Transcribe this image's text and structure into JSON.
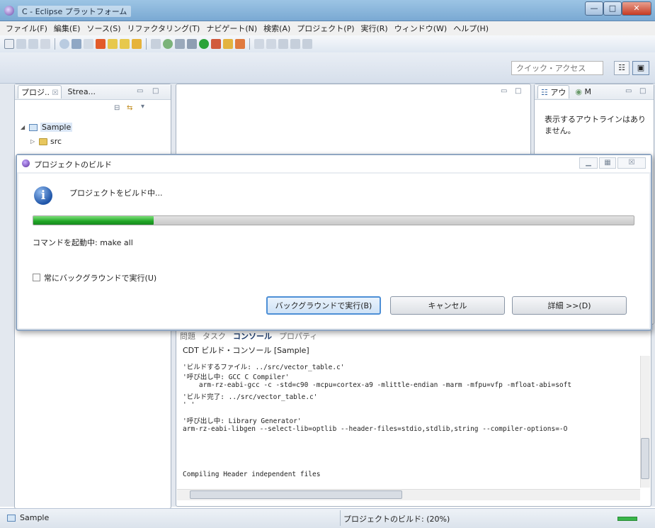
{
  "window": {
    "title": "C - Eclipse プラットフォーム",
    "min_glyph": "—",
    "max_glyph": "□",
    "close_glyph": "✕"
  },
  "menu": [
    "ファイル(F)",
    "編集(E)",
    "ソース(S)",
    "リファクタリング(T)",
    "ナビゲート(N)",
    "検索(A)",
    "プロジェクト(P)",
    "実行(R)",
    "ウィンドウ(W)",
    "ヘルプ(H)"
  ],
  "toolbar": {
    "quick_access_placeholder": "クイック・アクセス",
    "perspective_1": "☷",
    "perspective_2": "▣"
  },
  "explorer": {
    "tabs": [
      "プロジ..",
      "Strea..."
    ],
    "tab_close": "☒",
    "project": "Sample",
    "folder": "src"
  },
  "outline": {
    "tabs": [
      "アウ",
      "M"
    ],
    "empty_message": "表示するアウトラインはありません。"
  },
  "console": {
    "tabs": [
      "問題",
      "タスク",
      "コンソール",
      "プロパティ"
    ],
    "title": "CDT ビルド・コンソール [Sample]",
    "lines": [
      "'ビルドするファイル: ../src/vector_table.c'",
      "'呼び出し中: GCC C Compiler'",
      "    arm-rz-eabi-gcc -c -std=c90 -mcpu=cortex-a9 -mlittle-endian -marm -mfpu=vfp -mfloat-abi=soft",
      "'ビルド完了: ../src/vector_table.c'",
      "' '",
      "'呼び出し中: Library Generator'",
      "arm-rz-eabi-libgen --select-lib=optlib --header-files=stdio,stdlib,string --compiler-options=-O",
      "",
      "",
      "",
      "Compiling Header independent files"
    ]
  },
  "status": {
    "project": "Sample",
    "build": "プロジェクトのビルド: (20%)"
  },
  "dialog": {
    "title": "プロジェクトのビルド",
    "message": "プロジェクトをビルド中...",
    "progress": 0.2,
    "command": "コマンドを起動中: make all",
    "checkbox_label": "常にバックグラウンドで実行(U)",
    "btn_background": "バックグラウンドで実行(B)",
    "btn_cancel": "キャンセル",
    "btn_details": "詳細 >>(D)",
    "info_glyph": "i"
  }
}
